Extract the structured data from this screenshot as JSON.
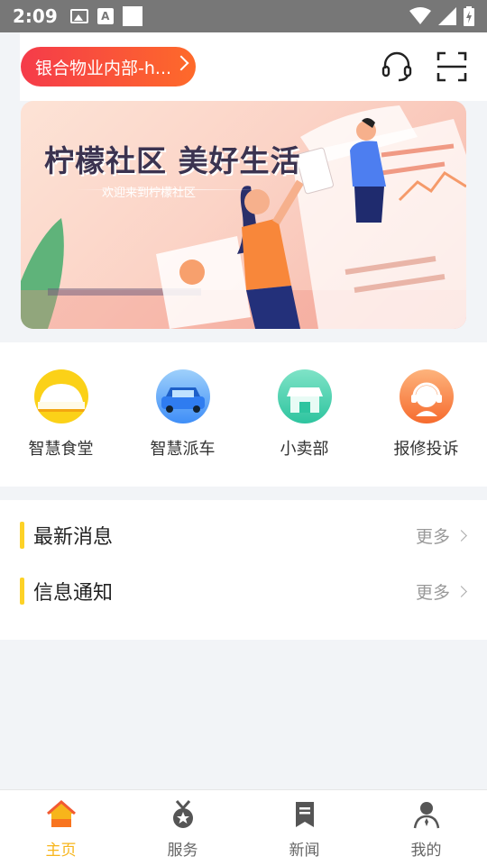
{
  "status_bar": {
    "time": "2:09",
    "icons": [
      "image-icon",
      "a-icon",
      "square-icon",
      "wifi-icon",
      "signal-icon",
      "battery-icon"
    ]
  },
  "header": {
    "location": "银合物业内部-h...",
    "icons": [
      "headset-icon",
      "scan-icon"
    ]
  },
  "banner": {
    "title": "柠檬社区  美好生活",
    "subtitle": "欢迎来到柠檬社区"
  },
  "quick_menu": [
    {
      "label": "智慧食堂",
      "icon": "canteen-icon",
      "color": "#fbd118"
    },
    {
      "label": "智慧派车",
      "icon": "car-icon",
      "color": "#3f8ef7"
    },
    {
      "label": "小卖部",
      "icon": "shop-icon",
      "color": "#3ed2ae"
    },
    {
      "label": "报修投诉",
      "icon": "service-agent-icon",
      "color": "#fb7c3e"
    }
  ],
  "lists": [
    {
      "title": "最新消息",
      "more": "更多"
    },
    {
      "title": "信息通知",
      "more": "更多"
    }
  ],
  "tabs": [
    {
      "label": "主页",
      "icon": "home-icon",
      "active": true
    },
    {
      "label": "服务",
      "icon": "medal-icon",
      "active": false
    },
    {
      "label": "新闻",
      "icon": "news-icon",
      "active": false
    },
    {
      "label": "我的",
      "icon": "person-icon",
      "active": false
    }
  ],
  "colors": {
    "accent": "#f7b51b",
    "pill_start": "#f53b4a",
    "pill_end": "#fe6a2a",
    "bullet": "#fdd227"
  }
}
